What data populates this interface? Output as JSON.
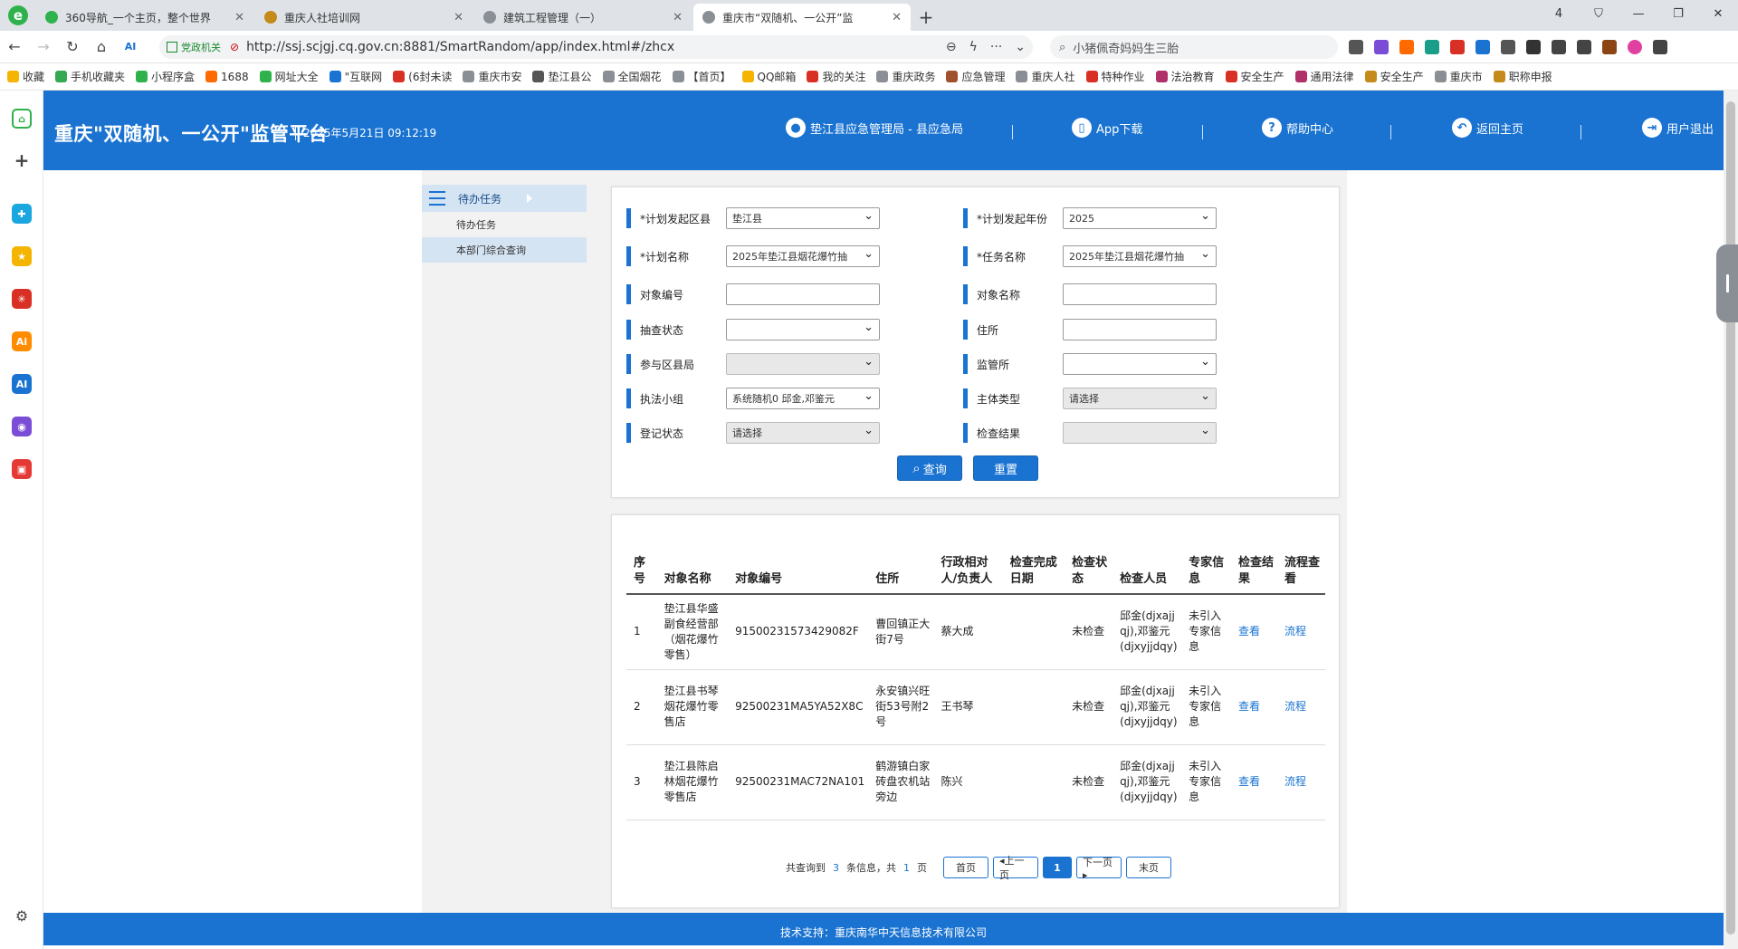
{
  "browser": {
    "tabs": [
      {
        "title": "360导航_一个主页，整个世界",
        "color": "#2fb24c",
        "active": false
      },
      {
        "title": "重庆人社培训网",
        "color": "#c48a1a",
        "active": false
      },
      {
        "title": "建筑工程管理（一）",
        "color": "#8a8f96",
        "active": false
      },
      {
        "title": "重庆市“双随机、一公开”监",
        "color": "#8a8f96",
        "active": true
      }
    ],
    "tab_count_badge": "4",
    "url_badge": "党政机关",
    "url": "http://ssj.scjgj.cq.gov.cn:8881/SmartRandom/app/index.html#/zhcx",
    "search_text": "小猪佩奇妈妈生三胎",
    "bookmarks": [
      {
        "label": "收藏",
        "color": "#f4b400"
      },
      {
        "label": "手机收藏夹",
        "color": "#34a853"
      },
      {
        "label": "小程序盒",
        "color": "#2fb24c"
      },
      {
        "label": "1688",
        "color": "#ff6a00"
      },
      {
        "label": "网址大全",
        "color": "#2fb24c"
      },
      {
        "label": "\"互联网",
        "color": "#1a73d1"
      },
      {
        "label": "(6封未读",
        "color": "#d93025"
      },
      {
        "label": "重庆市安",
        "color": "#8a8f96"
      },
      {
        "label": "垫江县公",
        "color": "#555555"
      },
      {
        "label": "全国烟花",
        "color": "#8a8f96"
      },
      {
        "label": "【首页】",
        "color": "#8a8f96"
      },
      {
        "label": "QQ邮箱",
        "color": "#f4b400"
      },
      {
        "label": "我的关注",
        "color": "#d93025"
      },
      {
        "label": "重庆政务",
        "color": "#8a8f96"
      },
      {
        "label": "应急管理",
        "color": "#a0522d"
      },
      {
        "label": "重庆人社",
        "color": "#8a8f96"
      },
      {
        "label": "特种作业",
        "color": "#d93025"
      },
      {
        "label": "法治教育",
        "color": "#b0306a"
      },
      {
        "label": "安全生产",
        "color": "#d93025"
      },
      {
        "label": "通用法律",
        "color": "#b0306a"
      },
      {
        "label": "安全生产",
        "color": "#c48a1a"
      },
      {
        "label": "重庆市",
        "color": "#8a8f96"
      },
      {
        "label": "职称申报",
        "color": "#c48a1a"
      }
    ]
  },
  "header": {
    "title": "重庆\"双随机、一公开\"监管平台",
    "datetime": "2025年5月21日 09:12:19",
    "user": "垫江县应急管理局 - 县应急局",
    "app_download": "App下载",
    "help": "帮助中心",
    "home": "返回主页",
    "logout": "用户退出"
  },
  "sidenav": {
    "main": "待办任务",
    "items": [
      "待办任务",
      "本部门综合查询"
    ]
  },
  "filters": {
    "plan_district_label": "*计划发起区县",
    "plan_district_value": "垫江县",
    "plan_year_label": "*计划发起年份",
    "plan_year_value": "2025",
    "plan_name_label": "*计划名称",
    "plan_name_value": "2025年垫江县烟花爆竹抽",
    "task_name_label": "*任务名称",
    "task_name_value": "2025年垫江县烟花爆竹抽",
    "object_code_label": "对象编号",
    "object_name_label": "对象名称",
    "check_status_label": "抽查状态",
    "address_label": "住所",
    "district_bureau_label": "参与区县局",
    "supervision_office_label": "监管所",
    "law_team_label": "执法小组",
    "law_team_value": "系统随机0 邱金,邓鉴元",
    "subject_type_label": "主体类型",
    "subject_type_value": "请选择",
    "register_status_label": "登记状态",
    "register_status_value": "请选择",
    "check_result_label": "检查结果",
    "query_btn": "查询",
    "reset_btn": "重置"
  },
  "table": {
    "headers": [
      "序号",
      "对象名称",
      "对象编号",
      "住所",
      "行政相对人/负责人",
      "检查完成日期",
      "检查状态",
      "检查人员",
      "专家信息",
      "检查结果",
      "流程查看"
    ],
    "rows": [
      {
        "no": "1",
        "name": "垫江县华盛副食经营部（烟花爆竹零售）",
        "code": "91500231573429082F",
        "address": "曹回镇正大街7号",
        "person": "蔡大成",
        "date": "",
        "status": "未检查",
        "inspectors": "邱金(djxajjqj),邓鉴元(djxyjjdqy)",
        "expert": "未引入专家信息",
        "result": "查看",
        "flow": "流程"
      },
      {
        "no": "2",
        "name": "垫江县书琴烟花爆竹零售店",
        "code": "92500231MA5YA52X8C",
        "address": "永安镇兴旺街53号附2号",
        "person": "王书琴",
        "date": "",
        "status": "未检查",
        "inspectors": "邱金(djxajjqj),邓鉴元(djxyjjdqy)",
        "expert": "未引入专家信息",
        "result": "查看",
        "flow": "流程"
      },
      {
        "no": "3",
        "name": "垫江县陈启林烟花爆竹零售店",
        "code": "92500231MAC72NA101",
        "address": "鹤游镇白家砖盘农机站旁边",
        "person": "陈兴",
        "date": "",
        "status": "未检查",
        "inspectors": "邱金(djxajjqj),邓鉴元(djxyjjdqy)",
        "expert": "未引入专家信息",
        "result": "查看",
        "flow": "流程"
      }
    ]
  },
  "pager": {
    "prefix": "共查询到",
    "count": "3",
    "mid": "条信息，共",
    "pages": "1",
    "suffix": "页",
    "first": "首页",
    "prev": "◂上一页",
    "current": "1",
    "next": "下一页▸",
    "last": "末页"
  },
  "footer": {
    "text": "技术支持：重庆南华中天信息技术有限公司"
  },
  "colors": {
    "brand_blue": "#1a73d1",
    "nav_selected": "#d5e4f3"
  }
}
